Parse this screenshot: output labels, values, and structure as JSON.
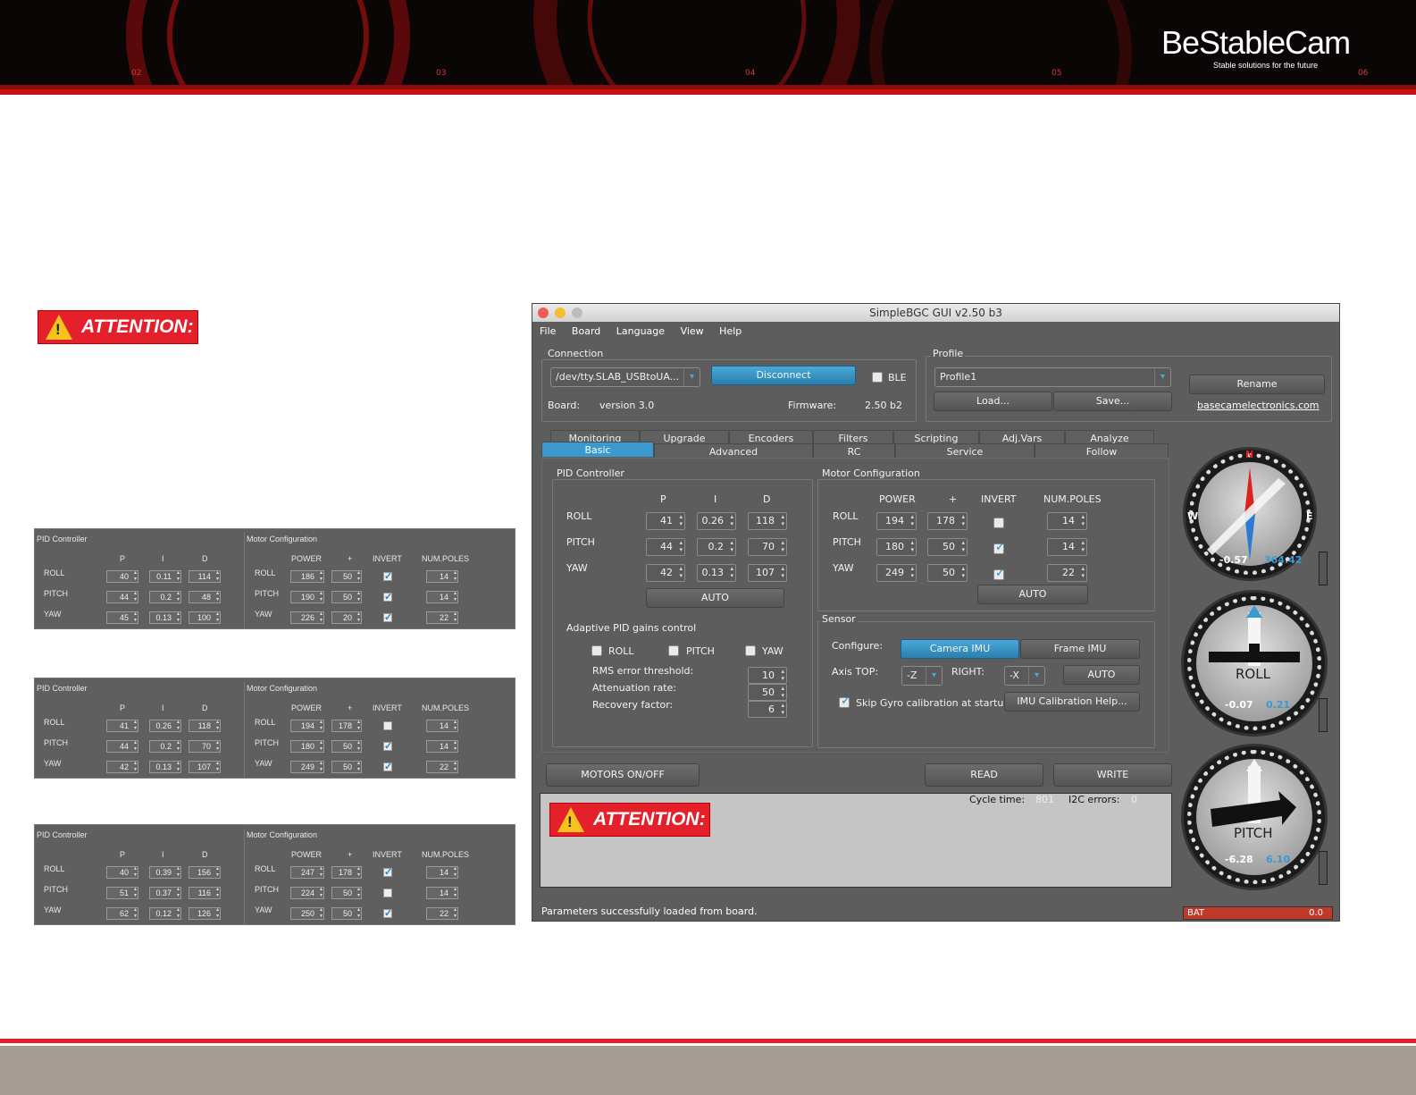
{
  "banner": {
    "logo_name": "BeStableCam",
    "logo_tagline": "Stable solutions for the future",
    "numbers": [
      "02",
      "03",
      "04",
      "05",
      "06"
    ]
  },
  "attention_label": "ATTENTION:",
  "mini_panels": [
    {
      "pid": [
        [
          "40",
          "0.11",
          "114"
        ],
        [
          "44",
          "0.2",
          "48"
        ],
        [
          "45",
          "0.13",
          "100"
        ]
      ],
      "motor": [
        [
          "186",
          "50",
          true,
          "14"
        ],
        [
          "190",
          "50",
          true,
          "14"
        ],
        [
          "226",
          "20",
          true,
          "22"
        ]
      ]
    },
    {
      "pid": [
        [
          "41",
          "0.26",
          "118"
        ],
        [
          "44",
          "0.2",
          "70"
        ],
        [
          "42",
          "0.13",
          "107"
        ]
      ],
      "motor": [
        [
          "194",
          "178",
          false,
          "14"
        ],
        [
          "180",
          "50",
          true,
          "14"
        ],
        [
          "249",
          "50",
          true,
          "22"
        ]
      ]
    },
    {
      "pid": [
        [
          "40",
          "0.39",
          "156"
        ],
        [
          "51",
          "0.37",
          "116"
        ],
        [
          "62",
          "0.12",
          "126"
        ]
      ],
      "motor": [
        [
          "247",
          "178",
          true,
          "14"
        ],
        [
          "224",
          "50",
          false,
          "14"
        ],
        [
          "250",
          "50",
          true,
          "22"
        ]
      ]
    }
  ],
  "labels": {
    "pid_controller": "PID Controller",
    "motor_configuration": "Motor Configuration",
    "p": "P",
    "i": "I",
    "d": "D",
    "power": "POWER",
    "plus": "+",
    "invert": "INVERT",
    "num_poles": "NUM.POLES",
    "roll": "ROLL",
    "pitch": "PITCH",
    "yaw": "YAW"
  },
  "window": {
    "title": "SimpleBGC GUI v2.50 b3",
    "menu": [
      "File",
      "Board",
      "Language",
      "View",
      "Help"
    ],
    "connection": {
      "label": "Connection",
      "port": "/dev/tty.SLAB_USBtoUA...",
      "disconnect": "Disconnect",
      "ble": "BLE",
      "board_label": "Board:",
      "board_value": "version 3.0",
      "firmware_label": "Firmware:",
      "firmware_value": "2.50 b2"
    },
    "profile": {
      "label": "Profile",
      "value": "Profile1",
      "load": "Load...",
      "save": "Save...",
      "rename": "Rename",
      "link": "basecamelectronics.com"
    },
    "tabs_back": [
      "Monitoring",
      "Upgrade",
      "Encoders",
      "Filters",
      "Scripting",
      "Adj.Vars",
      "Analyze"
    ],
    "tabs_front": [
      "Basic",
      "Advanced",
      "RC",
      "Service",
      "Follow"
    ],
    "pid": {
      "title": "PID Controller",
      "rows": [
        [
          "41",
          "0.26",
          "118"
        ],
        [
          "44",
          "0.2",
          "70"
        ],
        [
          "42",
          "0.13",
          "107"
        ]
      ],
      "auto": "AUTO"
    },
    "motor": {
      "title": "Motor Configuration",
      "rows": [
        [
          "194",
          "178",
          false,
          "14"
        ],
        [
          "180",
          "50",
          true,
          "14"
        ],
        [
          "249",
          "50",
          true,
          "22"
        ]
      ],
      "auto": "AUTO"
    },
    "adaptive": {
      "title": "Adaptive PID gains control",
      "roll": "ROLL",
      "pitch": "PITCH",
      "yaw": "YAW",
      "rms_label": "RMS error threshold:",
      "rms": "10",
      "atten_label": "Attenuation rate:",
      "atten": "50",
      "recovery_label": "Recovery factor:",
      "recovery": "6"
    },
    "sensor": {
      "title": "Sensor",
      "configure": "Configure:",
      "camera_imu": "Camera IMU",
      "frame_imu": "Frame IMU",
      "axis_top_label": "Axis TOP:",
      "axis_top": "-Z",
      "right_label": "RIGHT:",
      "right": "-X",
      "auto": "AUTO",
      "skip_gyro": "Skip Gyro calibration at startu",
      "imu_help": "IMU Calibration Help..."
    },
    "motors_onoff": "MOTORS ON/OFF",
    "read": "READ",
    "write": "WRITE",
    "cycle_label": "Cycle time:",
    "cycle_value": "801",
    "i2c_label": "I2C errors:",
    "i2c_value": "0",
    "status": "Parameters successfully loaded from board.",
    "bat_label": "BAT",
    "bat_value": "0.0",
    "gauges": {
      "yaw": {
        "n": "N",
        "w": "W",
        "e": "E",
        "val1": "-0.57",
        "val2": "364.42"
      },
      "roll": {
        "label": "ROLL",
        "val1": "-0.07",
        "val2": "0.21"
      },
      "pitch": {
        "label": "PITCH",
        "val1": "-6.28",
        "val2": "6.10"
      }
    }
  },
  "colors": {
    "accent": "#3a9ad0",
    "brand_red": "#e4202a",
    "attention_yellow": "#f7c21b"
  }
}
